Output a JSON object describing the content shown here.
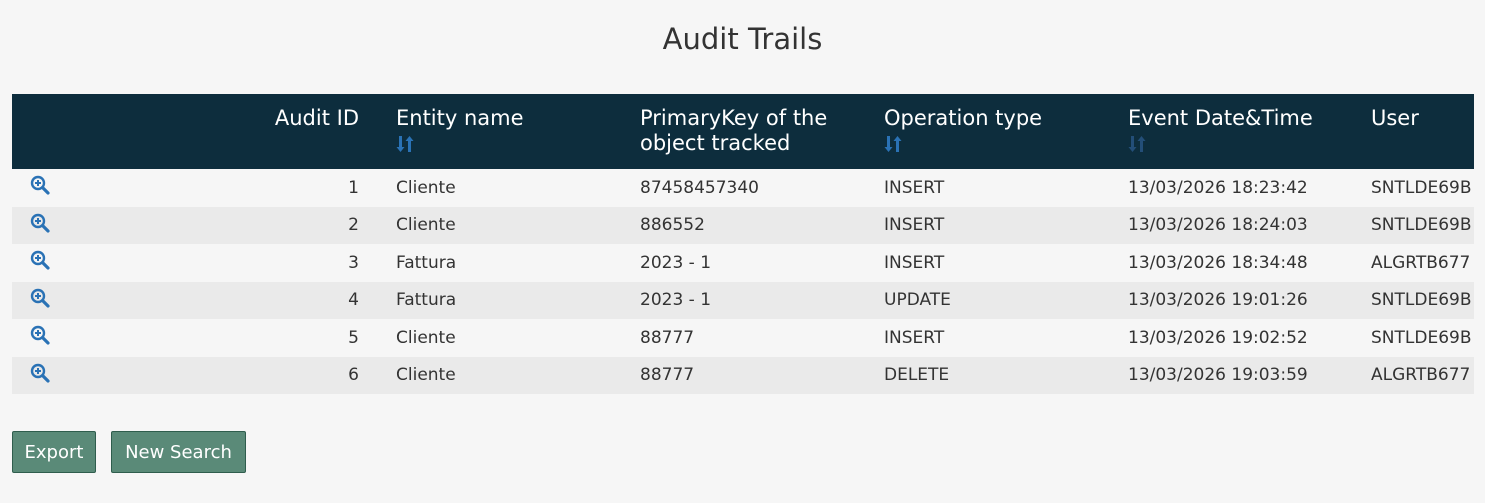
{
  "page": {
    "title": "Audit Trails"
  },
  "table": {
    "headers": {
      "audit_id": "Audit ID",
      "entity_name": "Entity name",
      "primary_key": "PrimaryKey of the object tracked",
      "operation_type": "Operation type",
      "event_datetime": "Event Date&Time",
      "user": "User"
    },
    "rows": [
      {
        "id": "1",
        "entity": "Cliente",
        "key": "87458457340",
        "operation": "INSERT",
        "datetime": "13/03/2026 18:23:42",
        "user": "SNTLDE69B"
      },
      {
        "id": "2",
        "entity": "Cliente",
        "key": "886552",
        "operation": "INSERT",
        "datetime": "13/03/2026 18:24:03",
        "user": "SNTLDE69B"
      },
      {
        "id": "3",
        "entity": "Fattura",
        "key": "2023 - 1",
        "operation": "INSERT",
        "datetime": "13/03/2026 18:34:48",
        "user": "ALGRTB677"
      },
      {
        "id": "4",
        "entity": "Fattura",
        "key": "2023 - 1",
        "operation": "UPDATE",
        "datetime": "13/03/2026 19:01:26",
        "user": "SNTLDE69B"
      },
      {
        "id": "5",
        "entity": "Cliente",
        "key": "88777",
        "operation": "INSERT",
        "datetime": "13/03/2026 19:02:52",
        "user": "SNTLDE69B"
      },
      {
        "id": "6",
        "entity": "Cliente",
        "key": "88777",
        "operation": "DELETE",
        "datetime": "13/03/2026 19:03:59",
        "user": "ALGRTB677"
      }
    ]
  },
  "buttons": {
    "export": "Export",
    "new_search": "New Search"
  },
  "icons": {
    "row_action": "zoom-in-icon",
    "sort": "sort-icon"
  },
  "colors": {
    "header_bg": "#0d2d3d",
    "header_text": "#ffffff",
    "icon_blue": "#2a72b5",
    "button_bg": "#5a8a78",
    "page_bg": "#f6f6f6",
    "row_alt_bg": "#eaeaea"
  }
}
